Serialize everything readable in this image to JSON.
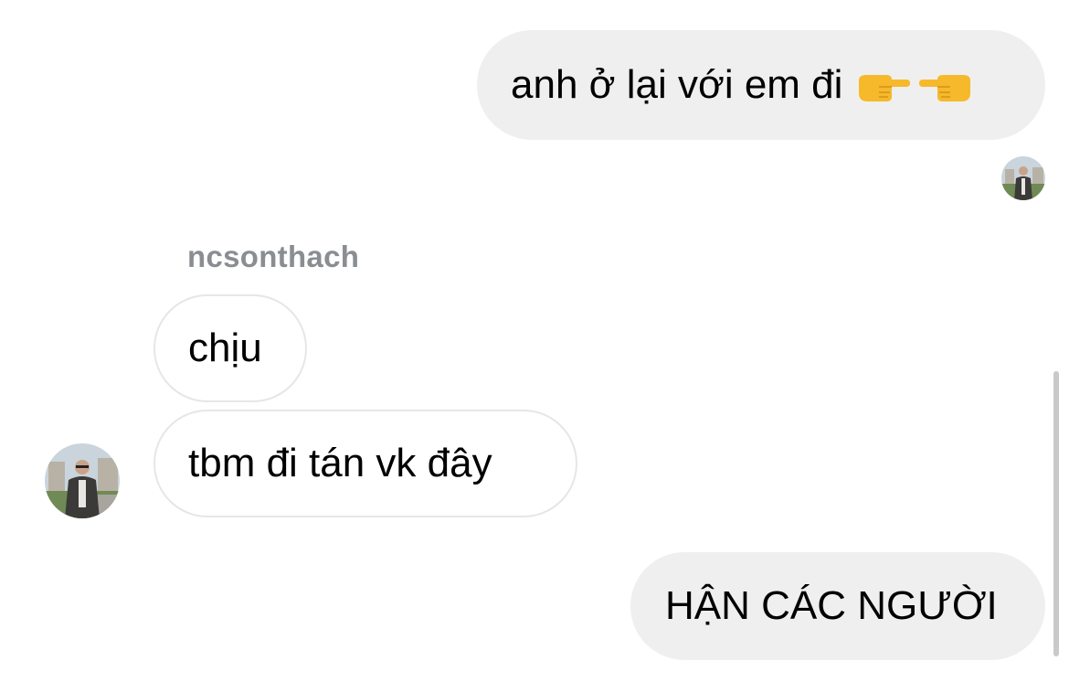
{
  "conversation": {
    "messages": [
      {
        "direction": "outgoing",
        "text": "anh ở lại với em đi",
        "emojis": [
          "backhand-index-pointing-right",
          "backhand-index-pointing-left"
        ]
      },
      {
        "direction": "incoming",
        "text": "chịu"
      },
      {
        "direction": "incoming",
        "text": "tbm đi tán vk đây"
      },
      {
        "direction": "outgoing",
        "text": "HẬN CÁC NGƯỜI"
      }
    ],
    "incoming_sender": "ncsonthach"
  },
  "colors": {
    "outgoing_bubble": "#efefef",
    "incoming_border": "#e6e6e6",
    "sender_label": "#8a8d91",
    "emoji_yellow": "#f6b92b"
  }
}
